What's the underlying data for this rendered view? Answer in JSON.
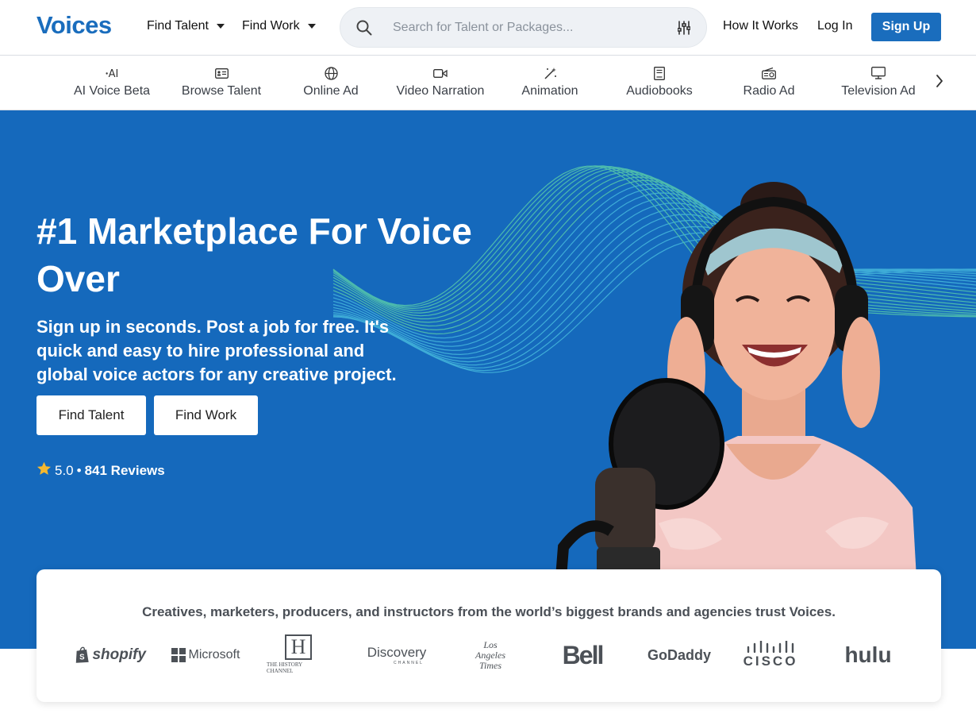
{
  "header": {
    "logo": "Voices",
    "find_talent": "Find Talent",
    "find_work": "Find Work",
    "search_placeholder": "Search for Talent or Packages...",
    "how_it_works": "How It Works",
    "login": "Log In",
    "signup": "Sign Up"
  },
  "categories": [
    {
      "label": "AI Voice Beta",
      "icon": "ai-icon"
    },
    {
      "label": "Browse Talent",
      "icon": "id-card-icon"
    },
    {
      "label": "Online Ad",
      "icon": "globe-icon"
    },
    {
      "label": "Video Narration",
      "icon": "video-camera-icon"
    },
    {
      "label": "Animation",
      "icon": "magic-wand-icon"
    },
    {
      "label": "Audiobooks",
      "icon": "book-icon"
    },
    {
      "label": "Radio Ad",
      "icon": "radio-icon"
    },
    {
      "label": "Television Ad",
      "icon": "tv-icon"
    }
  ],
  "hero": {
    "title": "#1 Marketplace For Voice Over",
    "subtitle": "Sign up in seconds. Post a job for free. It's quick and easy to hire professional and global voice actors for any creative project.",
    "find_talent_btn": "Find Talent",
    "find_work_btn": "Find Work",
    "rating_score": "5.0",
    "rating_separator": "•",
    "rating_reviews": "841 Reviews"
  },
  "brands": {
    "tagline": "Creatives, marketers, producers, and instructors from the world’s biggest brands and agencies trust Voices.",
    "logos": [
      "shopify",
      "Microsoft",
      "H",
      "THE HISTORY CHANNEL",
      "Discovery",
      "CHANNEL",
      "Los",
      "Angeles",
      "Times",
      "Bell",
      "GoDaddy",
      "CISCO",
      "hulu"
    ]
  },
  "colors": {
    "brand_blue": "#1a6dbd",
    "hero_blue": "#1569bc",
    "star": "#f5b82e"
  }
}
